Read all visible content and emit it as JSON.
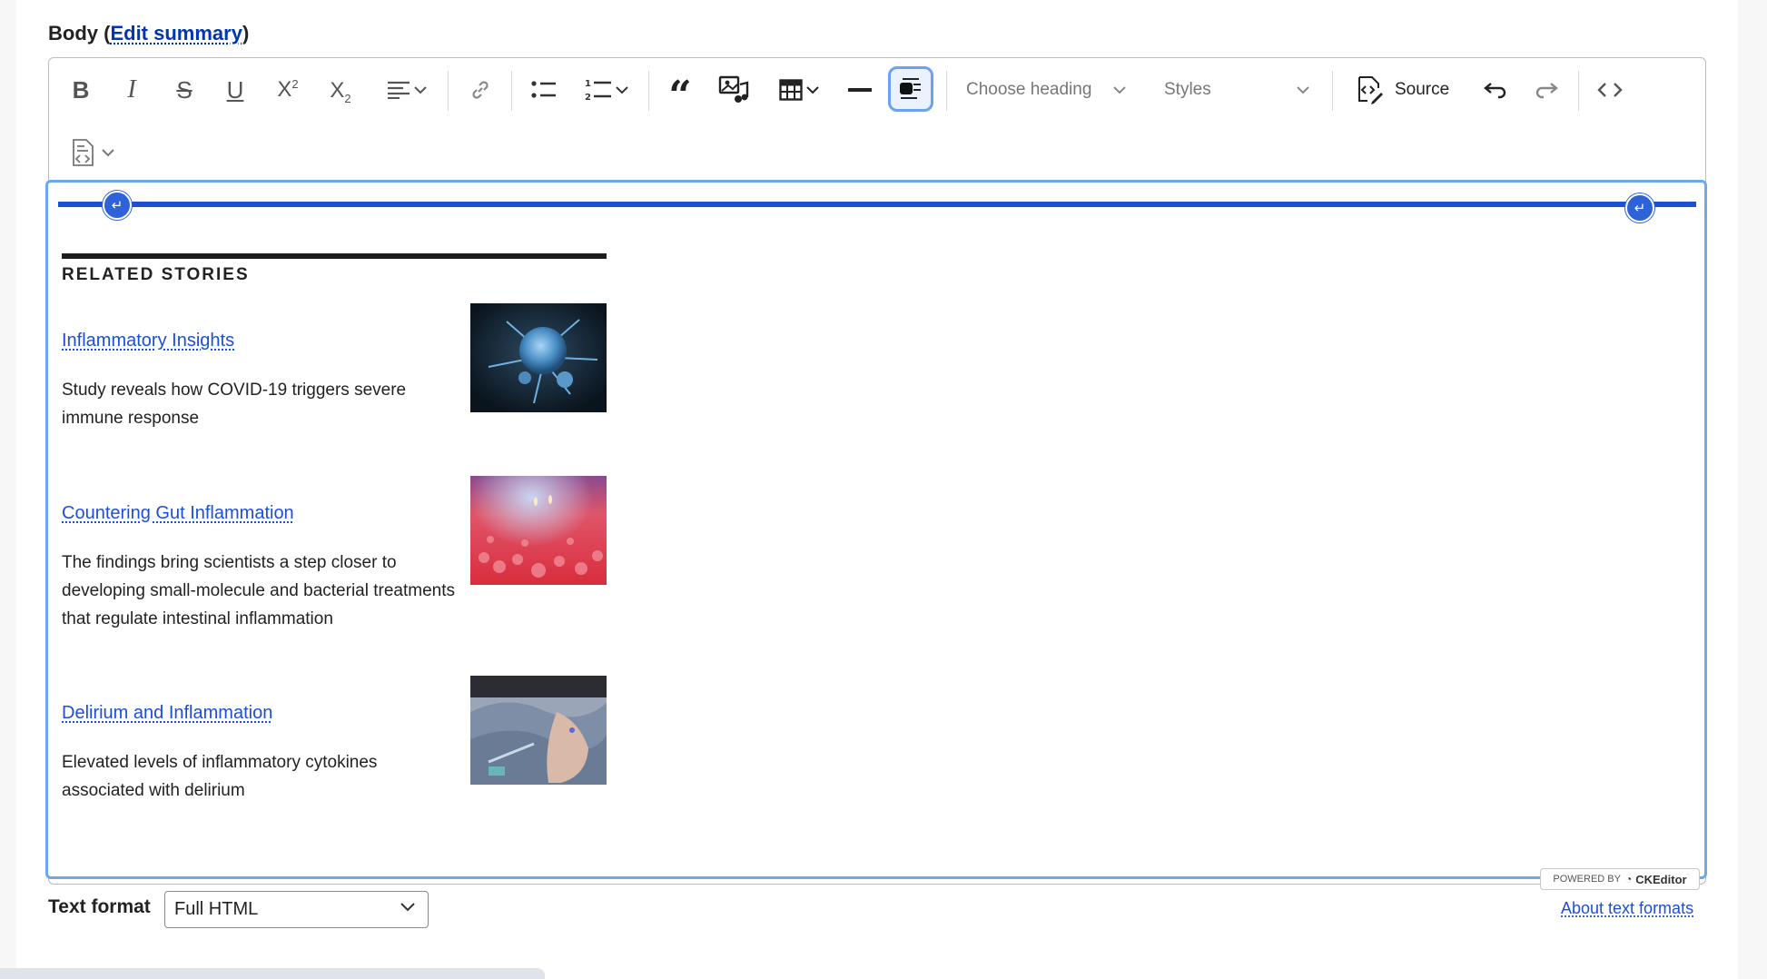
{
  "field": {
    "label_prefix": "Body (",
    "edit_summary_link": "Edit summary",
    "label_suffix": ")"
  },
  "toolbar": {
    "heading_placeholder": "Choose heading",
    "styles_placeholder": "Styles",
    "source_label": "Source",
    "active_tool": "insert-block-template"
  },
  "content": {
    "section_title": "RELATED STORIES",
    "stories": [
      {
        "link": "Inflammatory Insights",
        "description": "Study reveals how COVID-19 triggers severe immune response"
      },
      {
        "link": "Countering Gut Inflammation",
        "description": "The findings bring scientists a step closer to developing small-molecule and bacterial treatments that regulate intestinal inflammation"
      },
      {
        "link": "Delirium and Inflammation",
        "description": "Elevated levels of inflammatory cytokines associated with delirium"
      }
    ]
  },
  "badge": {
    "powered_by": "POWERED BY",
    "brand": "CKEditor"
  },
  "text_format": {
    "label": "Text format",
    "selected": "Full HTML",
    "about_link": "About text formats"
  },
  "colors": {
    "accent": "#1a4fd6",
    "link": "#1b4fd8",
    "focus": "#6aa8f0"
  }
}
